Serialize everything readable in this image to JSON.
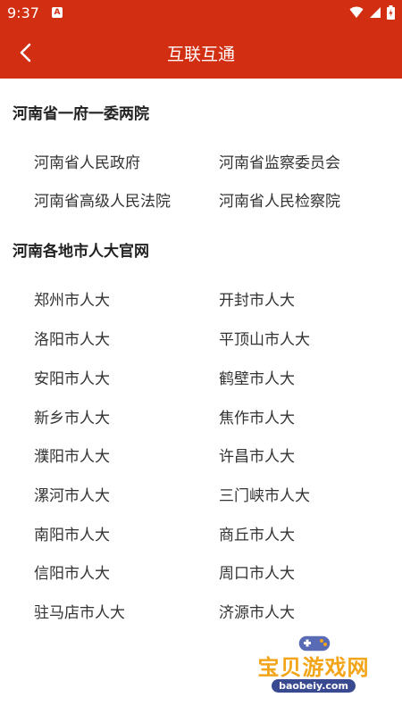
{
  "status_bar": {
    "time": "9:37",
    "notification_letter": "A",
    "icons": [
      "wifi-icon",
      "signal-icon",
      "battery-icon"
    ]
  },
  "header": {
    "title": "互联互通",
    "back_icon": "chevron-left-icon"
  },
  "colors": {
    "accent": "#d12e12",
    "text_primary": "#222222",
    "text_link": "#333333",
    "background": "#ffffff"
  },
  "sections": [
    {
      "title": "河南省一府一委两院",
      "items": [
        "河南省人民政府",
        "河南省监察委员会",
        "河南省高级人民法院",
        "河南省人民检察院"
      ]
    },
    {
      "title": "河南各地市人大官网",
      "items": [
        "郑州市人大",
        "开封市人大",
        "洛阳市人大",
        "平顶山市人大",
        "安阳市人大",
        "鹤壁市人大",
        "新乡市人大",
        "焦作市人大",
        "濮阳市人大",
        "许昌市人大",
        "漯河市人大",
        "三门峡市人大",
        "南阳市人大",
        "商丘市人大",
        "信阳市人大",
        "周口市人大",
        "驻马店市人大",
        "济源市人大"
      ]
    }
  ],
  "watermark": {
    "text": "宝贝游戏网",
    "url": "baobeiy.com"
  }
}
